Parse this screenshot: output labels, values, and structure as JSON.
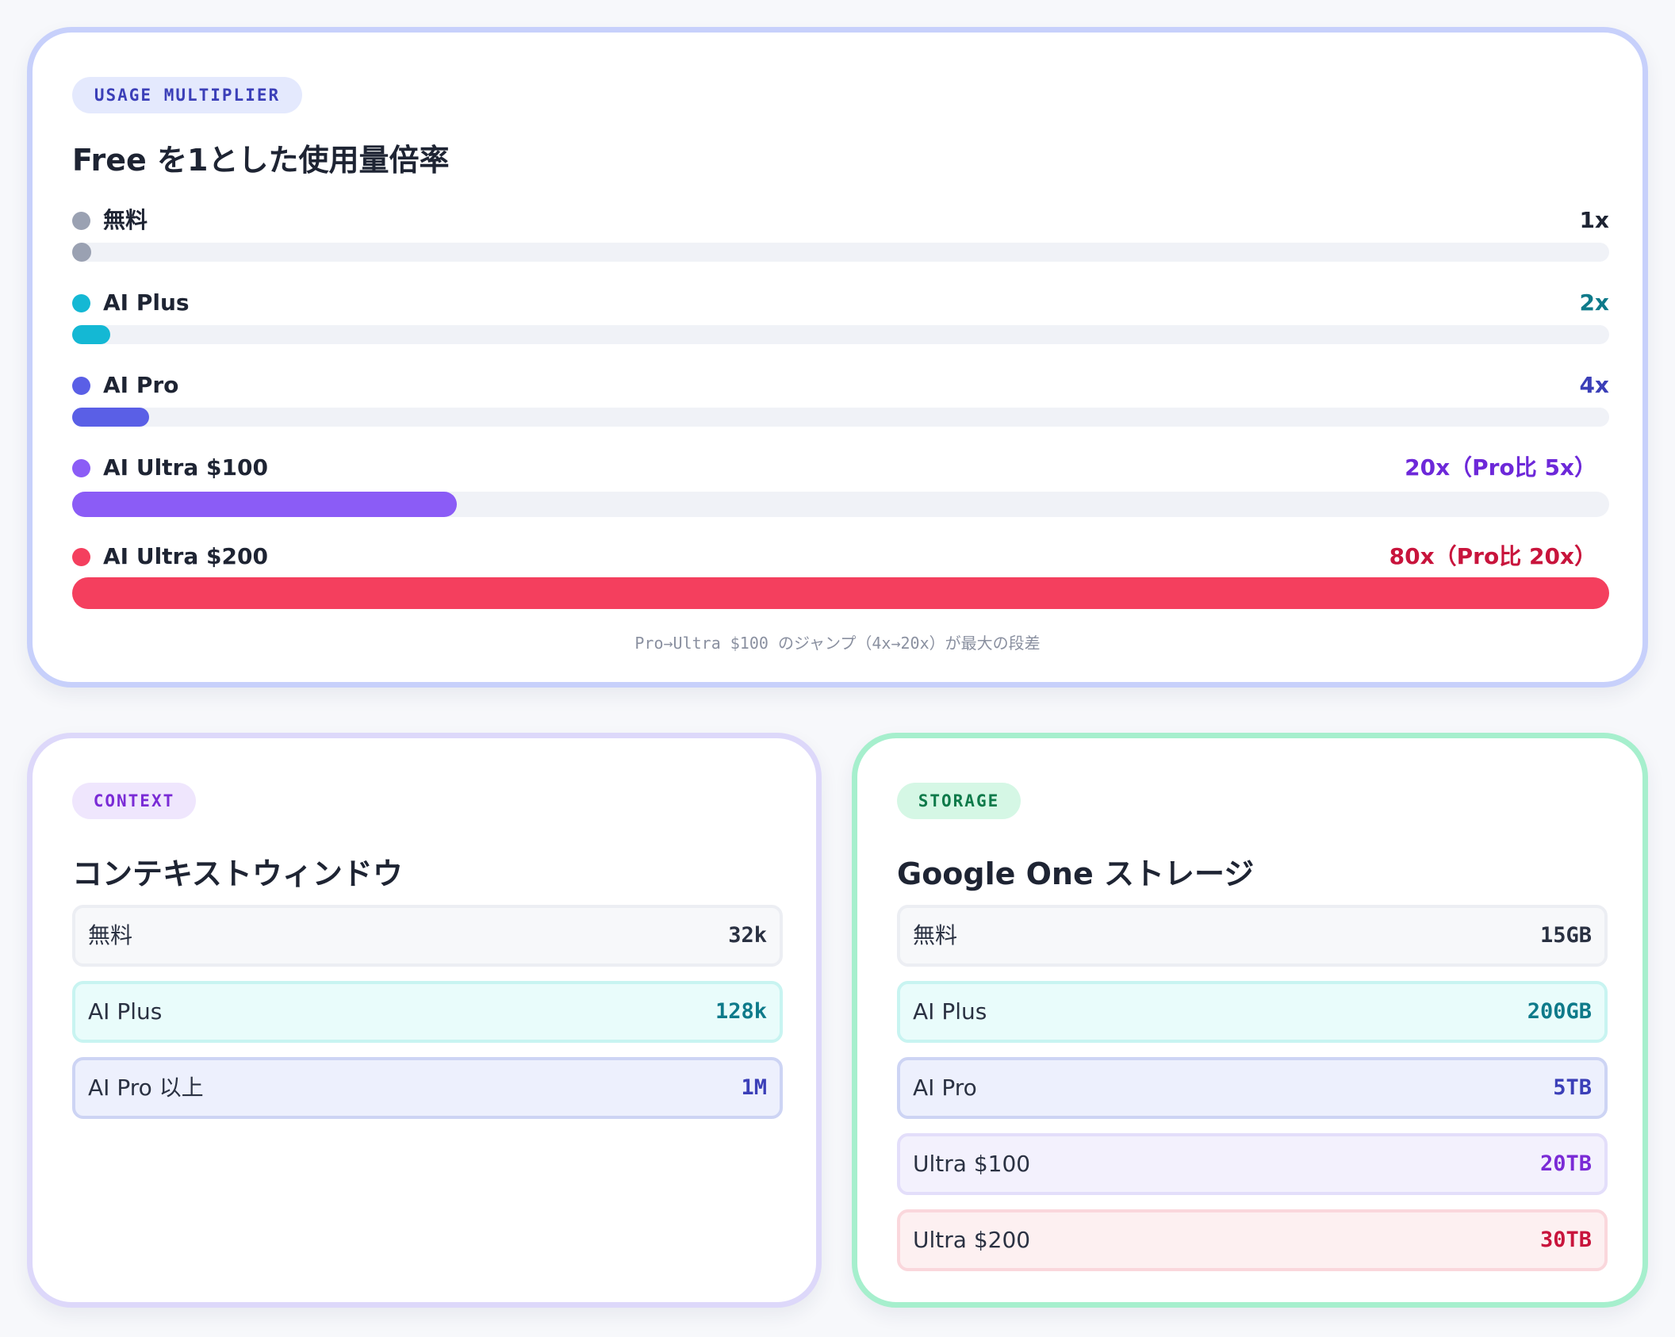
{
  "usage": {
    "pill": "USAGE MULTIPLIER",
    "title": "Free を1とした使用量倍率",
    "max_multiplier": 80,
    "rows": [
      {
        "name": "無料",
        "value_label": "1x",
        "multiplier": 1,
        "color": "#9aa1b2",
        "value_color": "#1e2433"
      },
      {
        "name": "AI Plus",
        "value_label": "2x",
        "multiplier": 2,
        "color": "#14b8d4",
        "value_color": "#0e7a8a"
      },
      {
        "name": "AI Pro",
        "value_label": "4x",
        "multiplier": 4,
        "color": "#5a5fe6",
        "value_color": "#3b3fb8"
      },
      {
        "name": "AI Ultra $100",
        "value_label": "20x（Pro比 5x）",
        "multiplier": 20,
        "color": "#8b5cf6",
        "value_color": "#6d28d9"
      },
      {
        "name": "AI Ultra $200",
        "value_label": "80x（Pro比 20x）",
        "multiplier": 80,
        "color": "#f43f5e",
        "value_color": "#c8143c"
      }
    ],
    "note": "Pro→Ultra $100 のジャンプ（4x→20x）が最大の段差"
  },
  "context": {
    "pill": "CONTEXT",
    "title": "コンテキストウィンドウ",
    "rows": [
      {
        "label": "無料",
        "value": "32k"
      },
      {
        "label": "AI Plus",
        "value": "128k"
      },
      {
        "label": "AI Pro 以上",
        "value": "1M"
      }
    ]
  },
  "storage": {
    "pill": "STORAGE",
    "title": "Google One ストレージ",
    "rows": [
      {
        "label": "無料",
        "value": "15GB"
      },
      {
        "label": "AI Plus",
        "value": "200GB"
      },
      {
        "label": "AI Pro",
        "value": "5TB"
      },
      {
        "label": "Ultra $100",
        "value": "20TB"
      },
      {
        "label": "Ultra $200",
        "value": "30TB"
      }
    ]
  }
}
